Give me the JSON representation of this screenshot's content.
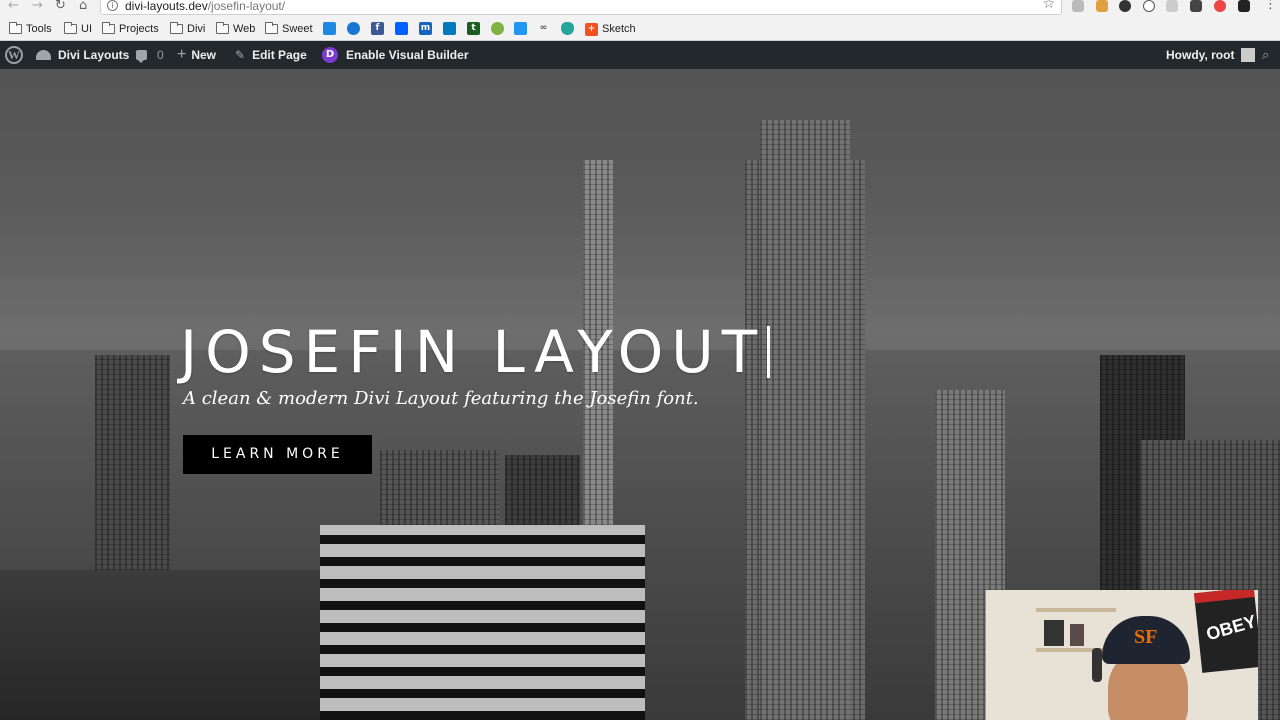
{
  "browser": {
    "url_host": "divi-layouts.dev",
    "url_path": "/josefin-layout/",
    "bookmarks": [
      "Tools",
      "UI",
      "Projects",
      "Divi",
      "Web",
      "Sweet",
      "Sketch"
    ]
  },
  "adminbar": {
    "site_name": "Divi Layouts",
    "comments_count": "0",
    "new_label": "New",
    "edit_label": "Edit Page",
    "visual_builder_label": "Enable Visual Builder",
    "howdy_label": "Howdy, root"
  },
  "hero": {
    "title": "JOSEFIN LAYOUT",
    "subtitle": "A clean & modern Divi Layout featuring the Josefin font.",
    "button_label": "LEARN MORE"
  },
  "webcam": {
    "poster_text": "OBEY",
    "cap_logo": "SF"
  },
  "colors": {
    "adminbar_bg": "#23282d",
    "divi_purple": "#7e3bd0",
    "button_bg": "#000000"
  }
}
